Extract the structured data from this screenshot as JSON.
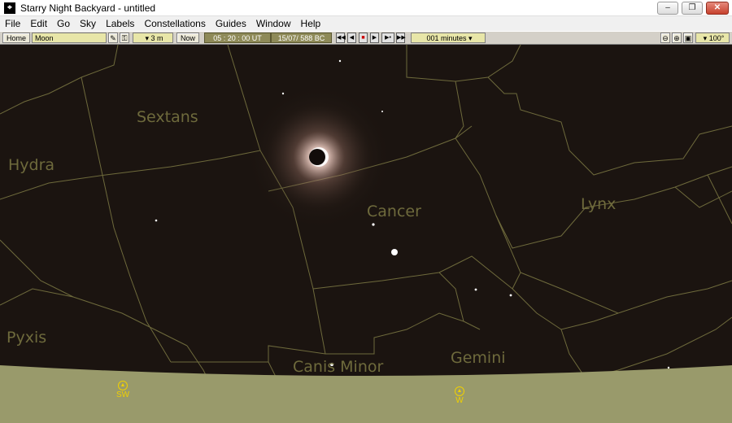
{
  "window": {
    "title": "Starry Night Backyard - untitled",
    "minimize_label": "–",
    "maximize_label": "❐",
    "close_label": "✕"
  },
  "menu": [
    "File",
    "Edit",
    "Go",
    "Sky",
    "Labels",
    "Constellations",
    "Guides",
    "Window",
    "Help"
  ],
  "toolbar": {
    "home_label": "Home",
    "location_value": "Moon",
    "elevation_value": "▾ 3 m",
    "now_label": "Now",
    "time_value": "05 : 20 : 00  UT",
    "date_value": "15/07/   588  BC",
    "step_value": "001 minutes ▾",
    "fov_value": "▾ 100°",
    "controls": [
      "◀◀",
      "◀",
      "■",
      "▶",
      "▶•",
      "▶▶"
    ]
  },
  "sky": {
    "constellations": [
      "Sextans",
      "Hydra",
      "Cancer",
      "Lynx",
      "Pyxis",
      "Canis Minor",
      "Gemini"
    ],
    "compass": [
      "SW",
      "W"
    ]
  },
  "colors": {
    "sky_background": "#1b1410",
    "ground": "#999a6b",
    "constellation_lines": "#6e6a3c",
    "compass": "#f0d000"
  }
}
